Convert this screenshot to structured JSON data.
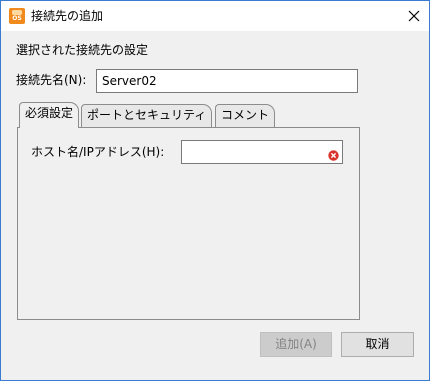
{
  "window": {
    "title": "接続先の追加",
    "app_icon_text": "OS",
    "close_symbol": "close-icon"
  },
  "form": {
    "section_heading": "選択された接続先の設定",
    "name_label": "接続先名(N):",
    "name_value": "Server02"
  },
  "tabs": [
    {
      "label": "必須設定",
      "active": true
    },
    {
      "label": "ポートとセキュリティ",
      "active": false
    },
    {
      "label": "コメント",
      "active": false
    }
  ],
  "required_tab": {
    "host_label": "ホスト名/IPアドレス(H):",
    "host_value": "",
    "validation_icon": "error-icon"
  },
  "buttons": {
    "add_label": "追加(A)",
    "add_enabled": false,
    "cancel_label": "取消"
  },
  "colors": {
    "window_border": "#3b7bd0",
    "error_icon": "#d9342b",
    "disabled_button_bg": "#cccccc"
  }
}
